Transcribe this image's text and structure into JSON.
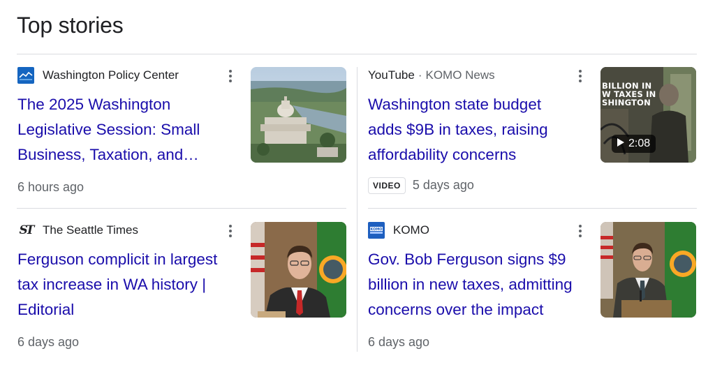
{
  "section_title": "Top stories",
  "stories": [
    {
      "source": "Washington Policy Center",
      "logo_icon": "washington-policy-center-logo",
      "headline": "The 2025 Washington Legislative Session: Small Business, Taxation, and…",
      "time": "6 hours ago",
      "thumbnail": "capitol-aerial-image"
    },
    {
      "source_platform": "YouTube",
      "source_separator": "·",
      "source": "KOMO News",
      "headline": "Washington state budget adds $9B in taxes, raising affordability concerns",
      "badge": "VIDEO",
      "time": "5 days ago",
      "thumbnail": "news-video-thumbnail",
      "thumbnail_caption": "BILLION IN W TAXES IN SHINGTON",
      "video_duration": "2:08",
      "play_icon": "play-icon"
    },
    {
      "source": "The Seattle Times",
      "logo_icon": "seattle-times-logo",
      "headline": "Ferguson complicit in largest tax increase in WA history | Editorial",
      "time": "6 days ago",
      "thumbnail": "ferguson-portrait-image"
    },
    {
      "source": "KOMO",
      "logo_icon": "komo-news-logo",
      "headline": "Gov. Bob Ferguson signs $9 billion in new taxes, admitting concerns over the impact",
      "time": "6 days ago",
      "thumbnail": "ferguson-podium-image"
    }
  ],
  "colors": {
    "link": "#1a0dab",
    "muted": "#5f6368",
    "divider": "#dadce0"
  }
}
